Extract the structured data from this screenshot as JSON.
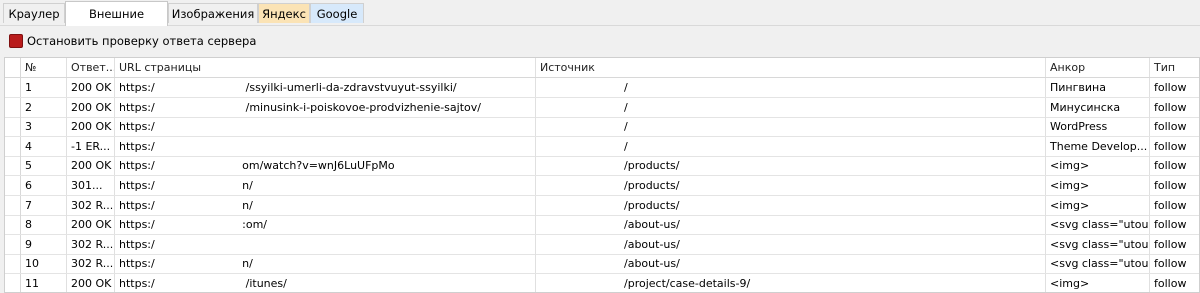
{
  "tabs": [
    {
      "label": "Краулер"
    },
    {
      "label": "Внешние ссылки"
    },
    {
      "label": "Изображения"
    },
    {
      "label": "Яндекс"
    },
    {
      "label": "Google"
    }
  ],
  "toolbar": {
    "stop_label": "Остановить проверку ответа сервера"
  },
  "table": {
    "headers": {
      "num": "№",
      "response": "Ответ...",
      "url": "URL страницы",
      "source": "Источник",
      "anchor": "Анкор",
      "type": "Тип"
    },
    "rows": [
      {
        "num": "1",
        "response": "200 OK",
        "url": "https:/                          /ssyilki-umerli-da-zdravstvuyut-ssyilki/",
        "source": "/",
        "anchor": "Пингвина",
        "type": "follow"
      },
      {
        "num": "2",
        "response": "200 OK",
        "url": "https:/                          /minusink-i-poiskovoe-prodvizhenie-sajtov/",
        "source": "/",
        "anchor": "Минусинска",
        "type": "follow"
      },
      {
        "num": "3",
        "response": "200 OK",
        "url": "https:/",
        "source": "/",
        "anchor": "WordPress",
        "type": "follow"
      },
      {
        "num": "4",
        "response": "-1 ER...",
        "url": "https:/",
        "source": "/",
        "anchor": "Theme Develop...",
        "type": "follow"
      },
      {
        "num": "5",
        "response": "200 OK",
        "url": "https:/                         om/watch?v=wnJ6LuUFpMo",
        "source": "/products/",
        "anchor": "<img>",
        "type": "follow"
      },
      {
        "num": "6",
        "response": "301...",
        "url": "https:/                         n/",
        "source": "/products/",
        "anchor": "<img>",
        "type": "follow"
      },
      {
        "num": "7",
        "response": "302 R...",
        "url": "https:/                         n/",
        "source": "/products/",
        "anchor": "<img>",
        "type": "follow"
      },
      {
        "num": "8",
        "response": "200 OK",
        "url": "https:/                         :om/",
        "source": "/about-us/",
        "anchor": "<svg class=\"utou...",
        "type": "follow"
      },
      {
        "num": "9",
        "response": "302 R...",
        "url": "https:/",
        "source": "/about-us/",
        "anchor": "<svg class=\"utou...",
        "type": "follow"
      },
      {
        "num": "10",
        "response": "302 R...",
        "url": "https:/                         n/",
        "source": "/about-us/",
        "anchor": "<svg class=\"utou...",
        "type": "follow"
      },
      {
        "num": "11",
        "response": "200 OK",
        "url": "https:/                          /itunes/",
        "source": "/project/case-details-9/",
        "anchor": "<img>",
        "type": "follow"
      }
    ]
  },
  "colors": {
    "stop": "#b91c1c",
    "yandex_tab": "#fbe3b5",
    "google_tab": "#d7e9fb"
  }
}
